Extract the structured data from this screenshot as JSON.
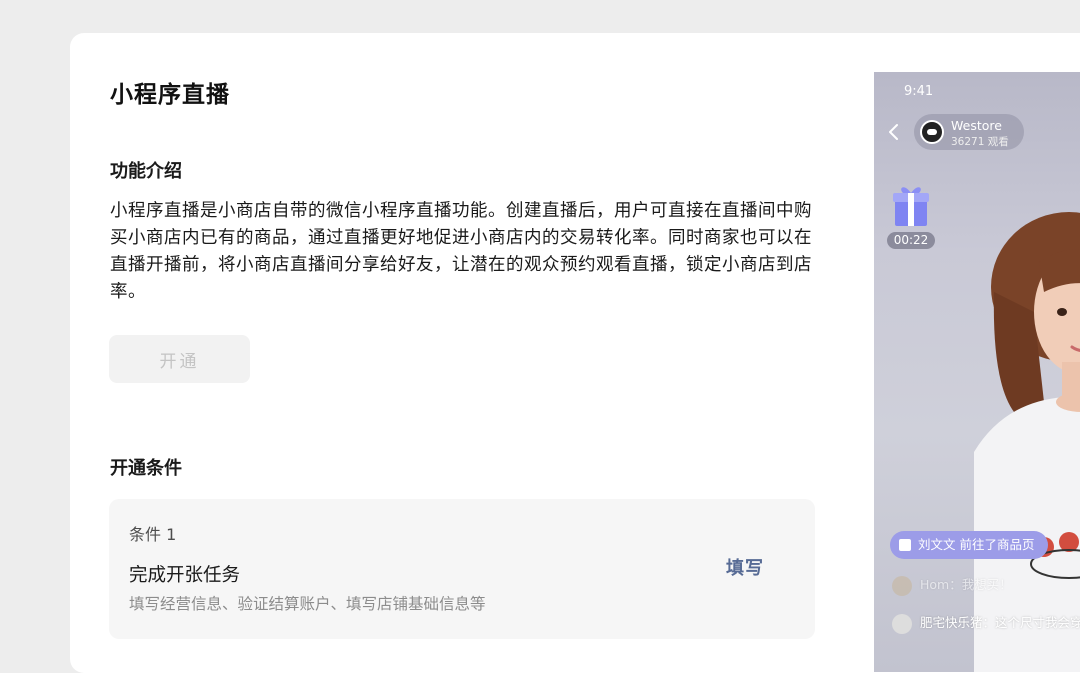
{
  "page": {
    "title": "小程序直播"
  },
  "intro": {
    "heading": "功能介绍",
    "body": "小程序直播是小商店自带的微信小程序直播功能。创建直播后，用户可直接在直播间中购买小商店内已有的商品，通过直播更好地促进小商店内的交易转化率。同时商家也可以在直播开播前，将小商店直播间分享给好友，让潜在的观众预约观看直播，锁定小商店到店率。"
  },
  "actions": {
    "open_label": "开通"
  },
  "conditions": {
    "heading": "开通条件",
    "items": [
      {
        "label": "条件 1",
        "name": "完成开张任务",
        "description": "填写经营信息、验证结算账户、填写店铺基础信息等",
        "action_label": "填写"
      }
    ]
  },
  "preview": {
    "status_time": "9:41",
    "host_name": "Westore",
    "viewers": "36271 观看",
    "gift_timer": "00:22",
    "notice": "刘文文 前往了商品页",
    "comments": [
      {
        "user": "Hom",
        "text": "我想买！"
      },
      {
        "user": "肥宅快乐猪",
        "text": "这个尺寸我会穿"
      }
    ]
  },
  "colors": {
    "link": "#576b95",
    "page_bg": "#ededed",
    "card_bg": "#ffffff",
    "disabled_btn_bg": "#f2f2f2",
    "notice_pill": "#9c9ce8"
  }
}
